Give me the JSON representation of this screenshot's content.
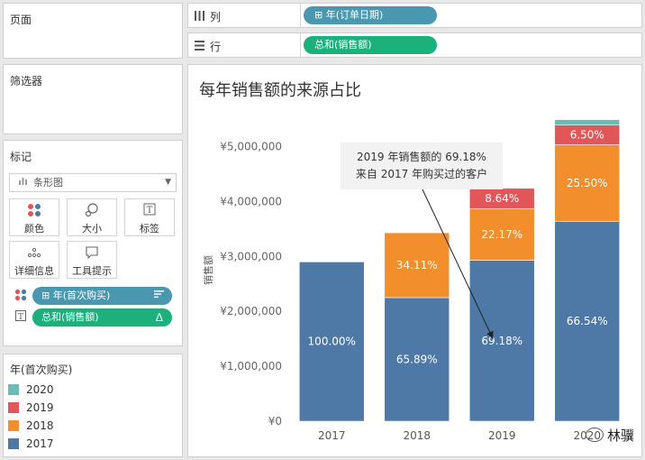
{
  "pages": {
    "title": "页面"
  },
  "filters": {
    "title": "筛选器"
  },
  "marks": {
    "title": "标记",
    "mark_type": {
      "icon": "bar-chart-icon",
      "label": "条形图"
    },
    "buttons": [
      {
        "name": "color",
        "icon": "color-dots-icon",
        "label": "颜色"
      },
      {
        "name": "size",
        "icon": "size-icon",
        "label": "大小"
      },
      {
        "name": "label",
        "icon": "text-label-icon",
        "label": "标签"
      },
      {
        "name": "detail",
        "icon": "detail-dots-icon",
        "label": "详细信息"
      },
      {
        "name": "tooltip",
        "icon": "tooltip-icon",
        "label": "工具提示"
      }
    ],
    "pills": [
      {
        "icon": "color-dots-icon",
        "label": "年(首次购买)",
        "prefix": "⊞",
        "suffix_icon": "sort-icon"
      },
      {
        "icon": "text-label-icon",
        "label": "总和(销售额)",
        "prefix": "",
        "suffix_icon": "delta-icon"
      }
    ]
  },
  "legend": {
    "title": "年(首次购买)",
    "items": [
      {
        "label": "2020",
        "color": "#6bbcb4"
      },
      {
        "label": "2019",
        "color": "#e15759"
      },
      {
        "label": "2018",
        "color": "#f28e2b"
      },
      {
        "label": "2017",
        "color": "#4e79a7"
      }
    ]
  },
  "shelves": {
    "columns": {
      "icon": "columns-icon",
      "label": "列",
      "pill": "⊞ 年(订单日期)"
    },
    "rows": {
      "icon": "rows-icon",
      "label": "行",
      "pill": "总和(销售额)"
    }
  },
  "watermark": {
    "text": "林骥"
  },
  "chart_data": {
    "type": "bar",
    "title": "每年销售额的来源占比",
    "ylabel": "销售额",
    "xlabel": "",
    "ylim": [
      0,
      5500000
    ],
    "yticks": [
      0,
      1000000,
      2000000,
      3000000,
      4000000,
      5000000
    ],
    "ytick_labels": [
      "¥0",
      "¥1,000,000",
      "¥2,000,000",
      "¥3,000,000",
      "¥4,000,000",
      "¥5,000,000"
    ],
    "categories": [
      "2017",
      "2018",
      "2019",
      "2020"
    ],
    "stacked": true,
    "series": [
      {
        "name": "2017",
        "color": "#4e79a7",
        "values": [
          2900000,
          2250000,
          2930000,
          3640000
        ],
        "labels": [
          "100.00%",
          "65.89%",
          "69.18%",
          "66.54%"
        ]
      },
      {
        "name": "2018",
        "color": "#f28e2b",
        "values": [
          0,
          1180000,
          940000,
          1390000
        ],
        "labels": [
          "",
          "34.11%",
          "22.17%",
          "25.50%"
        ]
      },
      {
        "name": "2019",
        "color": "#e15759",
        "values": [
          0,
          0,
          370000,
          360000
        ],
        "labels": [
          "",
          "",
          "8.64%",
          "6.50%"
        ]
      },
      {
        "name": "2020",
        "color": "#6bbcb4",
        "values": [
          0,
          0,
          0,
          100000
        ],
        "labels": [
          "",
          "",
          "",
          ""
        ]
      }
    ],
    "annotation": {
      "line1": "2019 年销售额的 69.18%",
      "line2": "来自 2017 年购买过的客户",
      "target_category": "2019",
      "target_value": 1500000
    }
  }
}
